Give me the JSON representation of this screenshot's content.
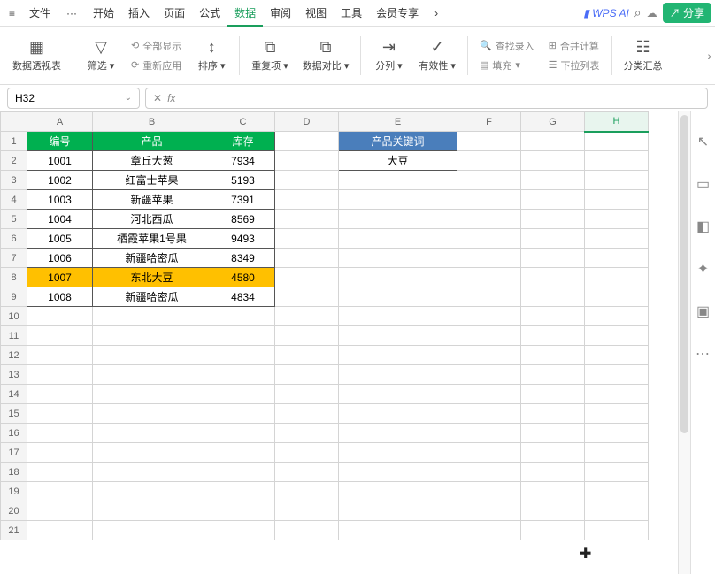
{
  "menu": {
    "hamburger": "≡",
    "file": "文件",
    "more": "···",
    "items": [
      "开始",
      "插入",
      "页面",
      "公式",
      "数据",
      "审阅",
      "视图",
      "工具",
      "会员专享"
    ],
    "active_index": 4,
    "nav_right": "›",
    "ai": "WPS AI",
    "share": "分享"
  },
  "ribbon": {
    "pivot": "数据透视表",
    "filter": "筛选",
    "show_all": "全部显示",
    "reapply": "重新应用",
    "sort": "排序",
    "dup": "重复项",
    "compare": "数据对比",
    "split": "分列",
    "validate": "有效性",
    "lookup": "查找录入",
    "consolidate": "合并计算",
    "fill": "填充",
    "dropdown": "下拉列表",
    "subtotal": "分类汇总"
  },
  "formula": {
    "name_box": "H32",
    "fx": "fx"
  },
  "columns": [
    "A",
    "B",
    "C",
    "D",
    "E",
    "F",
    "G",
    "H"
  ],
  "selected_col": "H",
  "row_count": 21,
  "headers_main": {
    "a": "编号",
    "b": "产品",
    "c": "库存"
  },
  "headers_side": {
    "e1": "产品关键词",
    "e2": "大豆"
  },
  "rows": [
    {
      "a": "1001",
      "b": "章丘大葱",
      "c": "7934"
    },
    {
      "a": "1002",
      "b": "红富士苹果",
      "c": "5193"
    },
    {
      "a": "1003",
      "b": "新疆苹果",
      "c": "7391"
    },
    {
      "a": "1004",
      "b": "河北西瓜",
      "c": "8569"
    },
    {
      "a": "1005",
      "b": "栖霞苹果1号果",
      "c": "9493"
    },
    {
      "a": "1006",
      "b": "新疆哈密瓜",
      "c": "8349"
    },
    {
      "a": "1007",
      "b": "东北大豆",
      "c": "4580",
      "hl": true
    },
    {
      "a": "1008",
      "b": "新疆哈密瓜",
      "c": "4834"
    }
  ]
}
